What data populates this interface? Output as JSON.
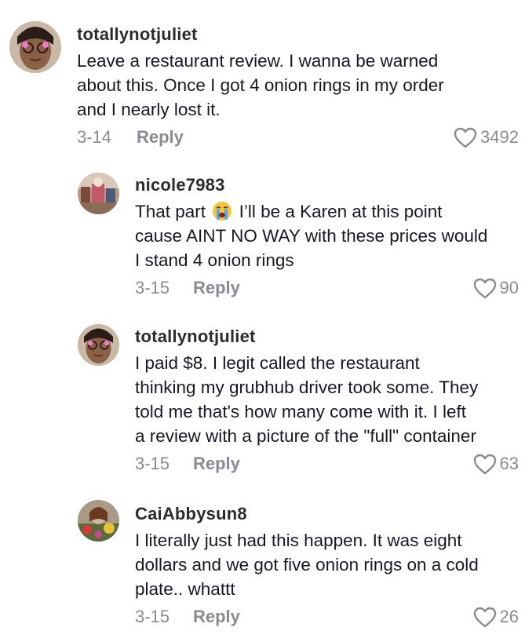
{
  "comments": [
    {
      "username": "totallynotjuliet",
      "lines": [
        "Leave a restaurant review. I wanna be warned",
        "about this. Once I got 4 onion rings in my order",
        "and I nearly lost it."
      ],
      "date": "3-14",
      "reply_label": "Reply",
      "likes": "3492"
    },
    {
      "username": "nicole7983",
      "line1_before": "That part",
      "emoji": "loudly-crying-face",
      "line1_after": "I’ll be a Karen at this point",
      "lines": [
        "cause AINT NO WAY with these prices would",
        "I stand 4 onion rings"
      ],
      "date": "3-15",
      "reply_label": "Reply",
      "likes": "90"
    },
    {
      "username": "totallynotjuliet",
      "lines": [
        "I paid $8. I legit called the restaurant",
        "thinking my grubhub driver took some. They",
        "told me that's how many come with it. I left",
        "a review with a picture of the \"full\" container"
      ],
      "date": "3-15",
      "reply_label": "Reply",
      "likes": "63"
    },
    {
      "username": "CaiAbbysun8",
      "lines": [
        "I literally just had this happen. It was eight",
        "dollars and we got five onion rings on a cold",
        "plate.. whattt"
      ],
      "date": "3-15",
      "reply_label": "Reply",
      "likes": "26"
    }
  ],
  "colors": {
    "text": "#161823",
    "secondary": "#8a8b91",
    "username": "#2b2b2b"
  },
  "icons": [
    "heart-icon",
    "loudly-crying-face-emoji"
  ]
}
